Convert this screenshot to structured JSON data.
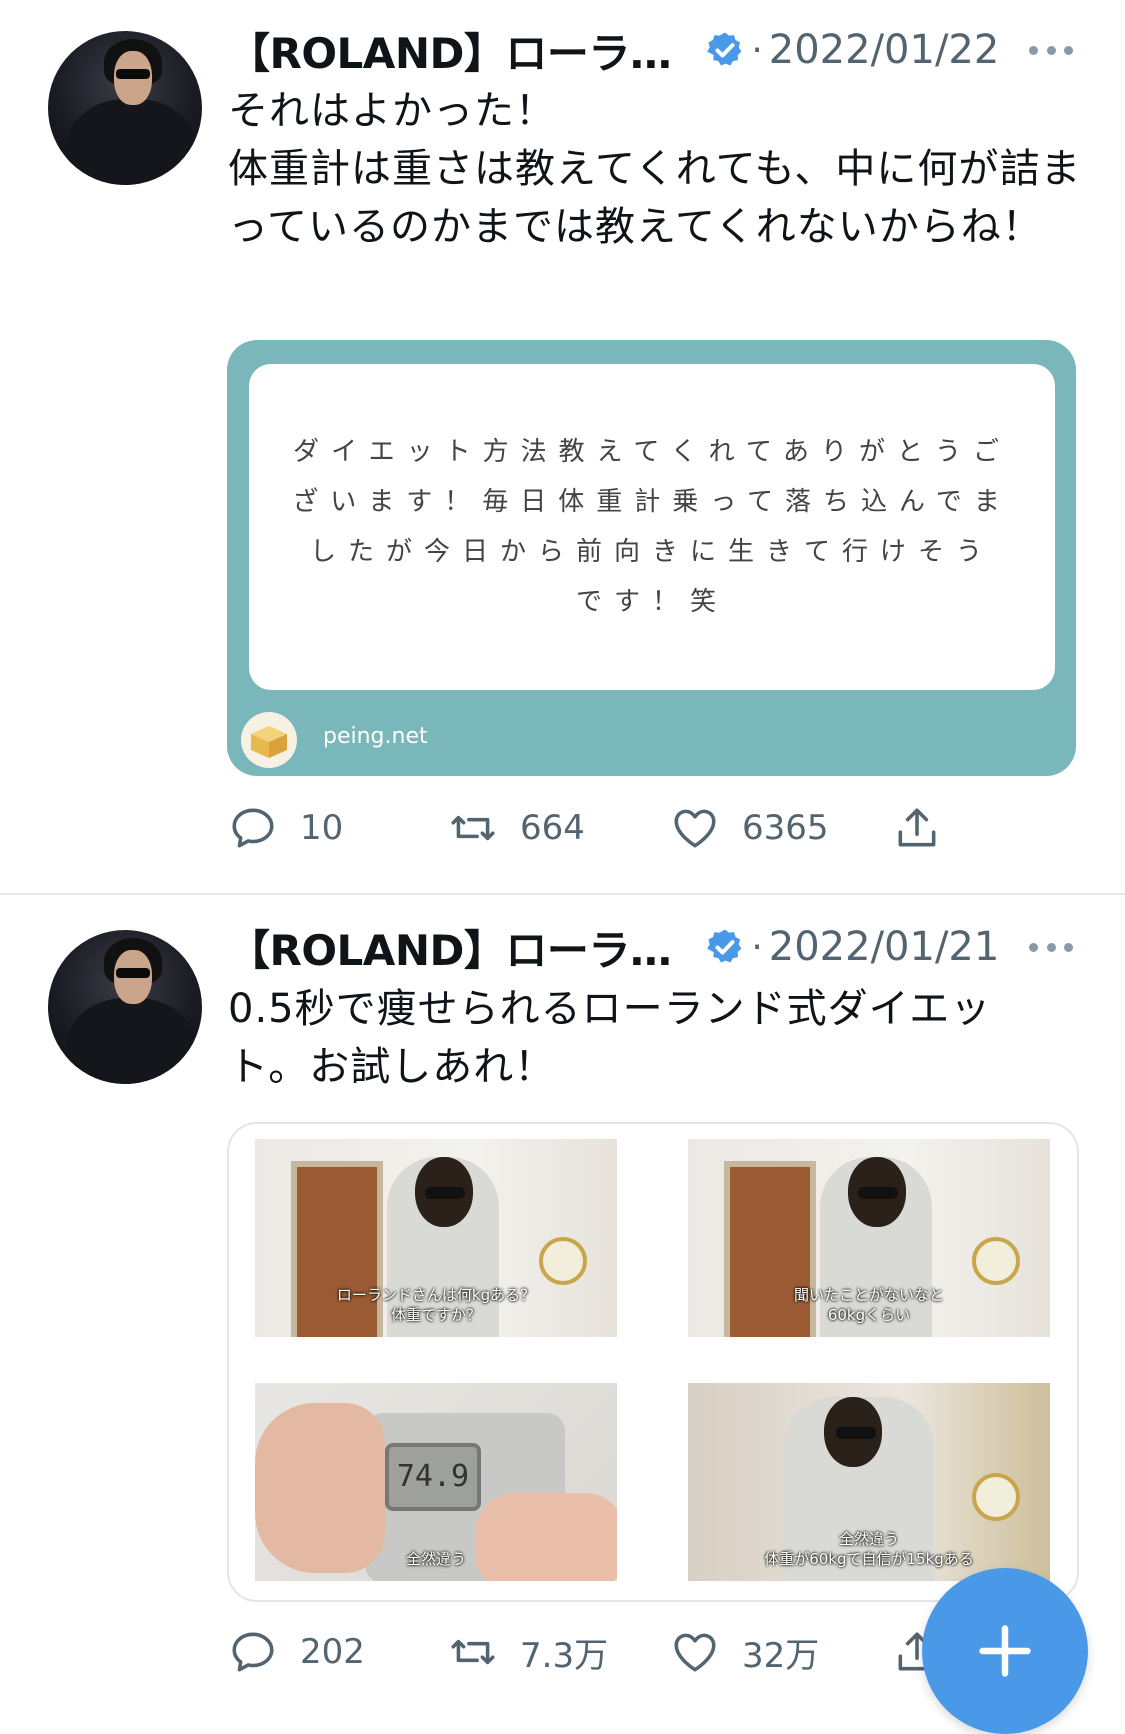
{
  "tweets": [
    {
      "author": "【ROLAND】ローラ…",
      "separator": "·",
      "date": "2022/01/22",
      "text": "それはよかった！\n体重計は重さは教えてくれても、中に何が詰まっているのかまでは教えてくれないからね！",
      "card": {
        "question": "ダイエット方法教えてくれてありがとうございます！毎日体重計乗って落ち込んでましたが今日から前向きに生きて行けそうです！笑",
        "site": "peing.net"
      },
      "stats": {
        "replies": "10",
        "retweets": "664",
        "likes": "6365"
      }
    },
    {
      "author": "【ROLAND】ローラ…",
      "separator": "·",
      "date": "2022/01/21",
      "text": "0.5秒で痩せられるローランド式ダイエット。お試しあれ！",
      "media": [
        {
          "caption": "ローランドさんは何kgある？\n体重ですか？"
        },
        {
          "caption": "聞いたことがないなと\n60kgくらい"
        },
        {
          "caption": "全然違う",
          "scale_reading": "74.9"
        },
        {
          "caption": "全然違う\n体重が60kgで自信が15kgある"
        }
      ],
      "stats": {
        "replies": "202",
        "retweets": "7.3万",
        "likes": "32万"
      }
    }
  ],
  "colors": {
    "verified": "#4a99e9",
    "card_teal": "#79b7ba",
    "fab": "#4a99e9",
    "muted": "#536471"
  },
  "icons": {
    "verified": "verified-badge-icon",
    "reply": "reply-bubble-icon",
    "retweet": "retweet-icon",
    "like": "heart-icon",
    "share": "share-upload-icon",
    "compose": "plus-icon"
  }
}
